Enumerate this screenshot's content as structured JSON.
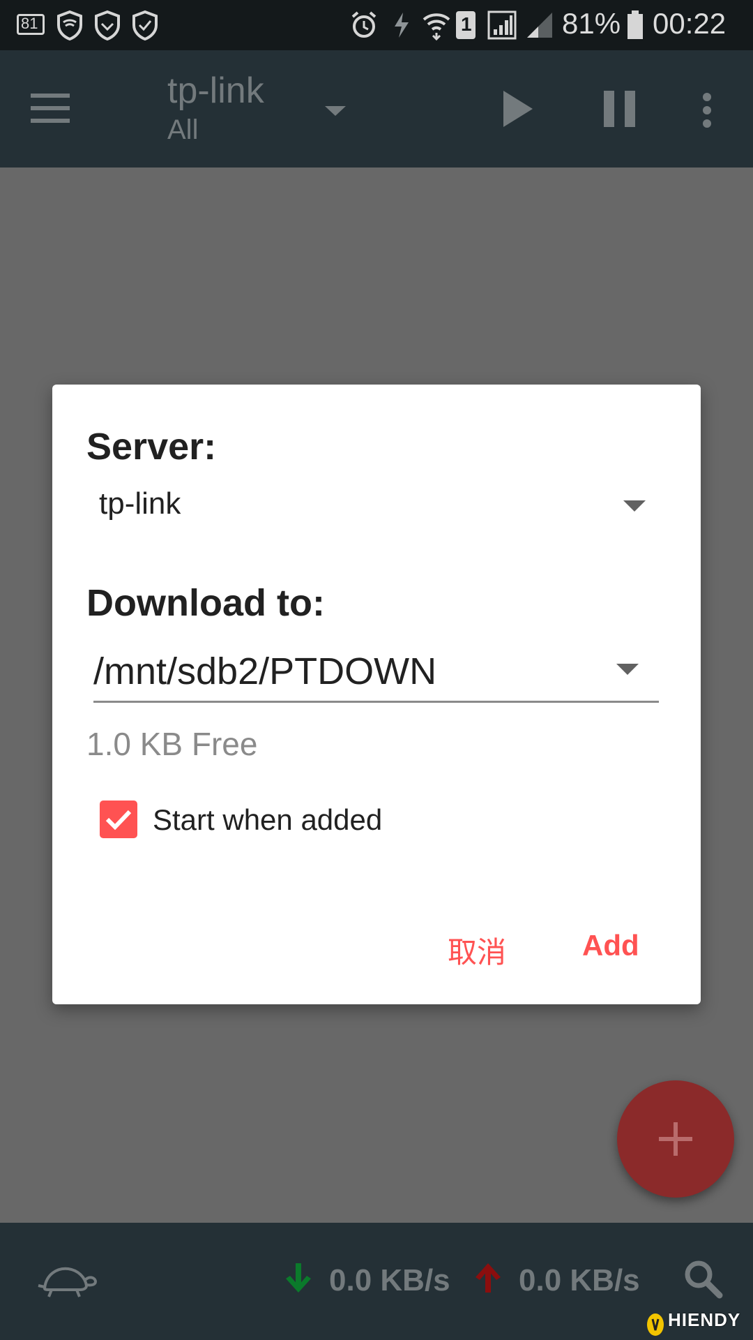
{
  "status_bar": {
    "notification_badge": "81",
    "battery_percent": "81%",
    "sim_slot": "1",
    "time": "00:22",
    "icons": [
      "notification-count-icon",
      "vpn-shield-icon",
      "shield-icon",
      "shield-check-icon",
      "alarm-icon",
      "data-saver-icon",
      "wifi-icon",
      "sim-icon",
      "signal-icon",
      "signal-weak-icon",
      "battery-icon"
    ]
  },
  "toolbar": {
    "title": "tp-link",
    "subtitle": "All",
    "icons": [
      "menu-icon",
      "dropdown-caret-icon",
      "play-icon",
      "pause-icon",
      "more-vert-icon"
    ]
  },
  "dialog": {
    "server_label": "Server:",
    "server_value": "tp-link",
    "download_label": "Download to:",
    "download_path": "/mnt/sdb2/PTDOWN",
    "free_space": "1.0 KB Free",
    "start_when_added_label": "Start when added",
    "start_when_added_checked": true,
    "cancel_label": "取消",
    "add_label": "Add",
    "accent_color": "#ff5252"
  },
  "fab": {
    "icon": "plus-icon",
    "color": "#8b2a2a"
  },
  "bottom_bar": {
    "download_speed": "0.0 KB/s",
    "upload_speed": "0.0 KB/s",
    "download_arrow_color": "#0b7a2b",
    "upload_arrow_color": "#8b0e0e",
    "icons": [
      "turtle-icon",
      "download-arrow-icon",
      "upload-arrow-icon",
      "search-icon"
    ]
  },
  "watermark": {
    "text": "HIENDY"
  }
}
